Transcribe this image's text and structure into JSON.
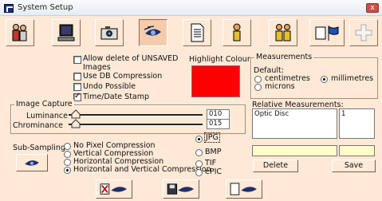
{
  "window": {
    "title": "System Setup",
    "close": "x"
  },
  "toolbar": {
    "icons": [
      "people-icon",
      "computer-icon",
      "camera-icon",
      "eye-icon",
      "document-icon",
      "person-icon",
      "two-people-icon",
      "flag-icon",
      "add-icon"
    ],
    "selected": "eye-icon"
  },
  "options": {
    "allow_delete": {
      "label": "Allow delete of UNSAVED Images",
      "checked": false
    },
    "use_db": {
      "label": "Use DB Compression",
      "checked": false
    },
    "undo": {
      "label": "Undo Possible",
      "checked": false
    },
    "timestamp": {
      "label": "Time/Date Stamp",
      "checked": true
    }
  },
  "highlight": {
    "title": "Highlight Colour",
    "color": "#ff0000"
  },
  "measurements": {
    "title": "Measurements",
    "default_label": "Default:",
    "units": [
      "centimetres",
      "millimetres",
      "microns"
    ],
    "selected": "millimetres",
    "relative_label": "Relative Measurements:",
    "items": [
      {
        "name": "Optic Disc",
        "value": "1"
      }
    ],
    "delete_label": "Delete",
    "save_label": "Save"
  },
  "capture": {
    "title": "Image Capture",
    "luminance_label": "Luminance",
    "luminance_value": "010",
    "chrominance_label": "Chrominance",
    "chrominance_value": "015",
    "subsampling_label": "Sub-Sampling",
    "compression": [
      "No Pixel Compression",
      "Vertical Compression",
      "Horizontal Compression",
      "Horizontal and Vertical Compression"
    ],
    "compression_selected": "Horizontal and Vertical Compression",
    "formats": [
      "JPG",
      "BMP",
      "TIF",
      "ePIC"
    ],
    "format_selected": "JPG"
  },
  "colors": {
    "bg": "#fde9d6",
    "accent": "#f4ccab",
    "highlight": "#ff0000"
  }
}
